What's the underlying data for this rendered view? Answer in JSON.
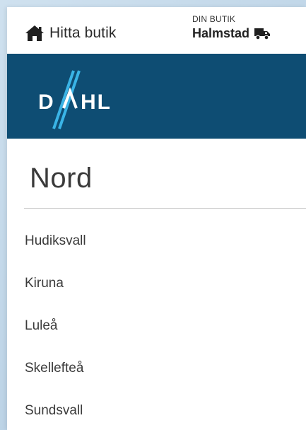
{
  "topbar": {
    "find_store_label": "Hitta butik",
    "find_store_icon": "home-icon",
    "store_caption": "DIN BUTIK",
    "store_name": "Halmstad",
    "delivery_icon": "truck-icon"
  },
  "brand": {
    "logo_text": "DAHL",
    "background_color": "#0e4d73",
    "accent_color": "#3ab4e6"
  },
  "region": {
    "title": "Nord",
    "stores": [
      "Hudiksvall",
      "Kiruna",
      "Luleå",
      "Skellefteå",
      "Sundsvall"
    ]
  }
}
